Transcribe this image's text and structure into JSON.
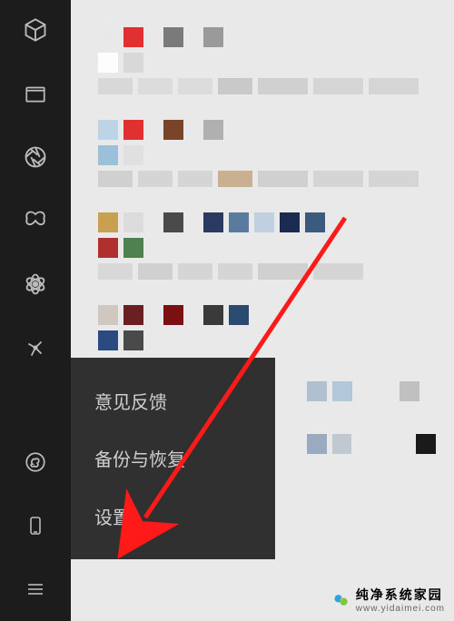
{
  "sidebar": {
    "icons": [
      "cube-icon",
      "folder-icon",
      "aperture-icon",
      "butterfly-icon",
      "atom-icon",
      "spark-icon"
    ],
    "bottom_icons": [
      "link-icon",
      "phone-icon",
      "menu-icon"
    ]
  },
  "popup": {
    "feedback": "意见反馈",
    "backup": "备份与恢复",
    "settings": "设置"
  },
  "watermark": {
    "title": "纯净系统家园",
    "url": "www.yidaimei.com"
  },
  "annotation": {
    "arrow_target": "settings"
  }
}
